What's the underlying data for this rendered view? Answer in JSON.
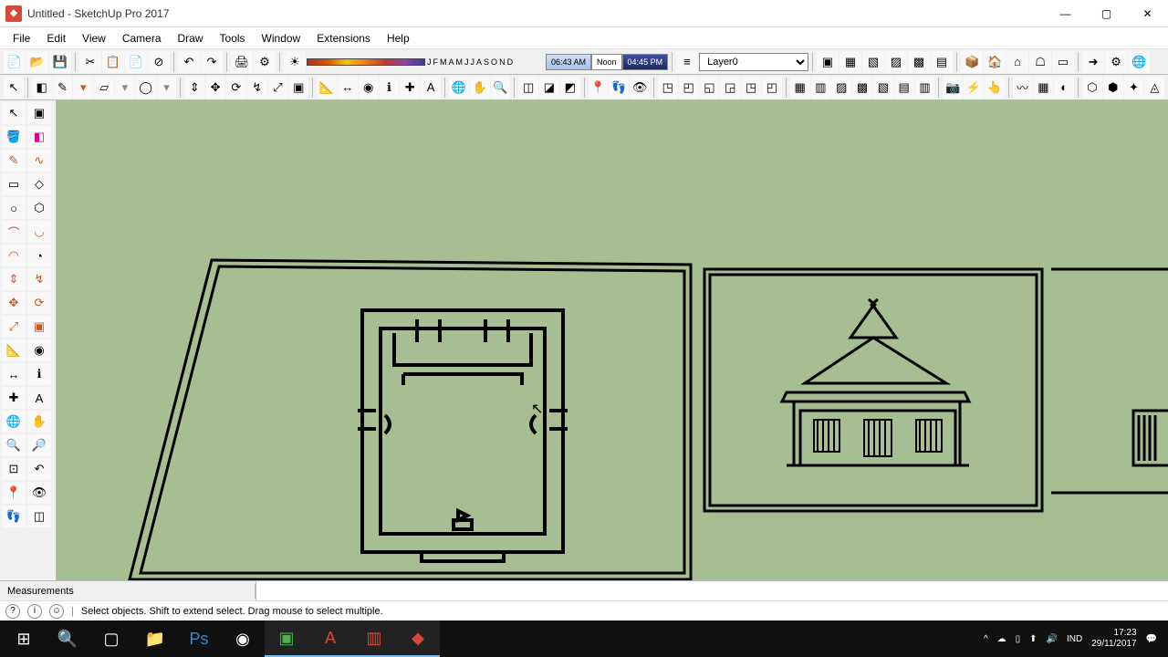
{
  "window": {
    "title": "Untitled - SketchUp Pro 2017",
    "min": "—",
    "max": "▢",
    "close": "✕"
  },
  "menu": {
    "file": "File",
    "edit": "Edit",
    "view": "View",
    "camera": "Camera",
    "draw": "Draw",
    "tools": "Tools",
    "window": "Window",
    "extensions": "Extensions",
    "help": "Help"
  },
  "months": {
    "j1": "J",
    "f": "F",
    "m1": "M",
    "a1": "A",
    "m2": "M",
    "j2": "J",
    "j3": "J",
    "a2": "A",
    "s": "S",
    "o": "O",
    "n": "N",
    "d": "D"
  },
  "shadows": {
    "start": "06:43 AM",
    "noon": "Noon",
    "end": "04:45 PM"
  },
  "layer": {
    "selected": "Layer0"
  },
  "status": {
    "measurements": "Measurements"
  },
  "tip": {
    "text": "Select objects. Shift to extend select. Drag mouse to select multiple."
  },
  "tray": {
    "lang": "IND",
    "time": "17:23",
    "date": "29/11/2017"
  },
  "icons": {
    "file_new": "📄",
    "file_open": "📂",
    "file_save": "💾",
    "cut": "✂",
    "copy": "📋",
    "paste": "📄",
    "delete": "⊘",
    "undo": "↶",
    "redo": "↷",
    "print": "🖨",
    "model_info": "⚙",
    "paint": "🎨",
    "select": "▭",
    "eraser": "◧",
    "line": "✎",
    "rect": "▱",
    "shape": "◯",
    "push": "⇕",
    "move": "✥",
    "rotate": "⟳",
    "scale": "⤢",
    "offset": "▣",
    "tape": "📐",
    "protractor": "◉",
    "text": "ℹ",
    "axes": "✚",
    "dim": "↔",
    "orbit": "🌐",
    "pan": "✋",
    "zoom": "🔍",
    "section": "◫",
    "walk": "👣",
    "look": "👁",
    "position": "📍",
    "iso": "◳",
    "top": "◰",
    "front": "◱",
    "right": "◲",
    "back": "◳",
    "left": "◰",
    "xray": "▦",
    "wire": "▨",
    "hidden": "▩",
    "shaded": "▧",
    "tex": "▤",
    "mono": "▥",
    "layer_icon": "≡",
    "arrow": "↖"
  }
}
